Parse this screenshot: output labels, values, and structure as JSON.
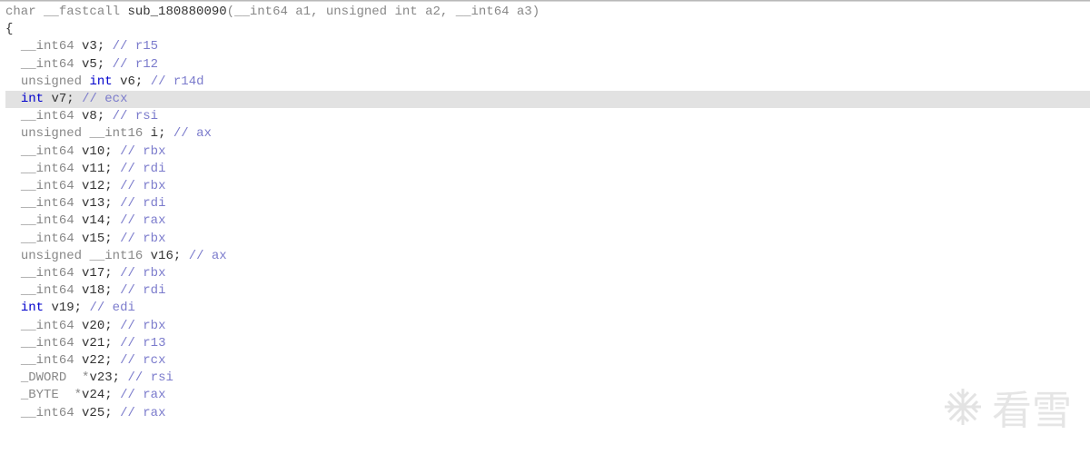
{
  "code": {
    "signature": {
      "ret_type": "char",
      "callconv": "__fastcall",
      "func_name": "sub_180880090",
      "params": "(__int64 a1, unsigned int a2, __int64 a3)"
    },
    "open_brace": "{",
    "highlighted_index": 4,
    "declarations": [
      {
        "type": "__int64",
        "name": "v3",
        "comment": "// r15"
      },
      {
        "type": "__int64",
        "name": "v5",
        "comment": "// r12"
      },
      {
        "type": "unsigned int",
        "name": "v6",
        "comment": "// r14d"
      },
      {
        "type": "int",
        "name": "v7",
        "comment": "// ecx"
      },
      {
        "type": "__int64",
        "name": "v8",
        "comment": "// rsi"
      },
      {
        "type": "unsigned __int16",
        "name": "i",
        "comment": "// ax"
      },
      {
        "type": "__int64",
        "name": "v10",
        "comment": "// rbx"
      },
      {
        "type": "__int64",
        "name": "v11",
        "comment": "// rdi"
      },
      {
        "type": "__int64",
        "name": "v12",
        "comment": "// rbx"
      },
      {
        "type": "__int64",
        "name": "v13",
        "comment": "// rdi"
      },
      {
        "type": "__int64",
        "name": "v14",
        "comment": "// rax"
      },
      {
        "type": "__int64",
        "name": "v15",
        "comment": "// rbx"
      },
      {
        "type": "unsigned __int16",
        "name": "v16",
        "comment": "// ax"
      },
      {
        "type": "__int64",
        "name": "v17",
        "comment": "// rbx"
      },
      {
        "type": "__int64",
        "name": "v18",
        "comment": "// rdi"
      },
      {
        "type": "int",
        "name": "v19",
        "comment": "// edi"
      },
      {
        "type": "__int64",
        "name": "v20",
        "comment": "// rbx"
      },
      {
        "type": "__int64",
        "name": "v21",
        "comment": "// r13"
      },
      {
        "type": "__int64",
        "name": "v22",
        "comment": "// rcx"
      },
      {
        "type": "_DWORD *",
        "name": "v23",
        "comment": "// rsi"
      },
      {
        "type": "_BYTE *",
        "name": "v24",
        "comment": "// rax"
      },
      {
        "type": "__int64",
        "name": "v25",
        "comment": "// rax"
      }
    ]
  },
  "watermark": {
    "text": "看雪"
  }
}
